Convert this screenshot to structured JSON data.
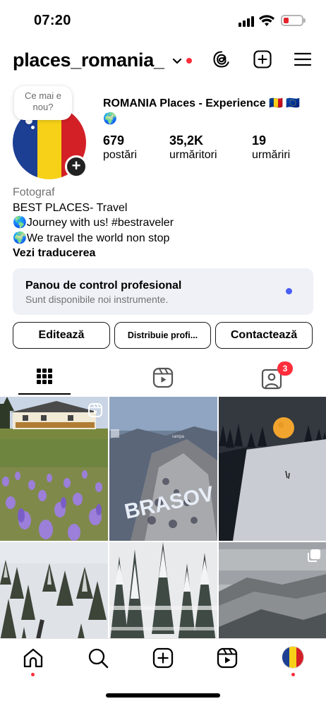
{
  "status_bar": {
    "time": "07:20"
  },
  "header": {
    "username": "places_romania_"
  },
  "profile": {
    "note": "Ce mai e nou?",
    "display_name": "ROMANIA  Places - Experience 🇷🇴 🇪🇺 🌍",
    "stats": [
      {
        "value": "679",
        "label": "postări"
      },
      {
        "value": "35,2K",
        "label": "urmăritori"
      },
      {
        "value": "19",
        "label": "urmăriri"
      }
    ],
    "category": "Fotograf",
    "bio_lines": [
      "BEST PLACES- Travel",
      "🌎Journey with us! #bestraveler",
      "🌍We travel the world non stop"
    ],
    "translate_label": "Vezi traducerea"
  },
  "dashboard": {
    "title": "Panou de control profesional",
    "subtitle": "Sunt disponibile noi instrumente.",
    "dot_color": "#4a5ef7"
  },
  "buttons": {
    "edit": "Editează",
    "share": "Distribuie profi...",
    "contact": "Contactează"
  },
  "tabs": {
    "items": [
      {
        "icon": "grid-icon",
        "active": true
      },
      {
        "icon": "reels-icon",
        "active": false
      },
      {
        "icon": "tagged-icon",
        "active": false,
        "badge": "3"
      }
    ]
  },
  "grid": {
    "posts": [
      {
        "icon": "crocus-field-cabin-photo",
        "type": "reel"
      },
      {
        "icon": "brasov-sign-photo",
        "overlay_text": "BRASOV"
      },
      {
        "icon": "full-moon-ski-slope-photo"
      },
      {
        "icon": "snowy-forest-cabin-aerial-photo"
      },
      {
        "icon": "snowy-forest-hut-photo"
      },
      {
        "icon": "mountain-valley-photo",
        "type": "carousel"
      }
    ]
  },
  "bottom_nav": {
    "items": [
      "home-icon",
      "search-icon",
      "create-icon",
      "reels-icon",
      "profile-avatar"
    ]
  },
  "colors": {
    "accent_red": "#ff2d3b",
    "flag_blue": "#1c3f94",
    "flag_yellow": "#f7d117",
    "flag_red": "#d32027",
    "dashboard_bg": "#eff1f6"
  }
}
